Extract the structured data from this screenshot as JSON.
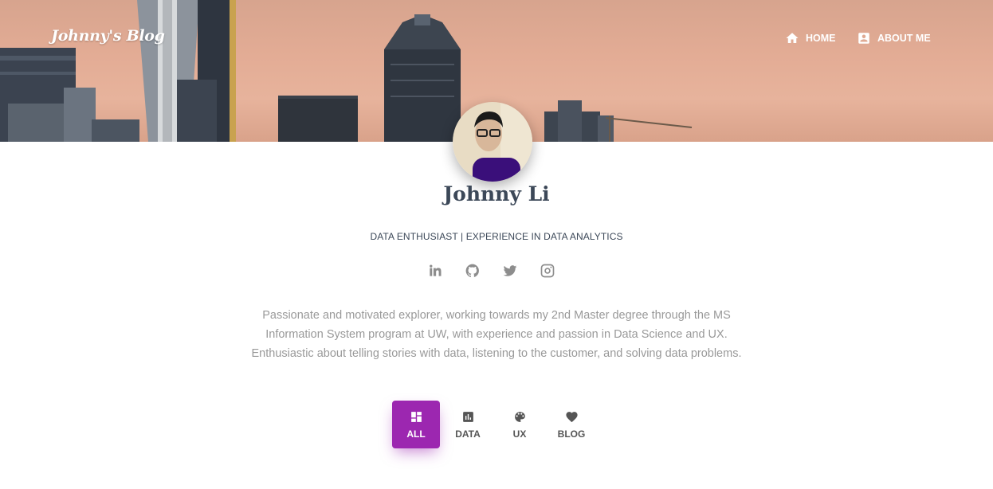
{
  "header": {
    "brand": "Johnny's Blog",
    "nav": [
      {
        "label": "HOME",
        "icon": "home-icon"
      },
      {
        "label": "ABOUT ME",
        "icon": "account-box-icon"
      }
    ],
    "banner": "city-skyline-at-dusk"
  },
  "profile": {
    "name": "Johnny Li",
    "tagline": "DATA ENTHUSIAST | EXPERIENCE IN DATA ANALYTICS",
    "social": [
      "linkedin-icon",
      "github-icon",
      "twitter-icon",
      "instagram-icon"
    ],
    "bio_lines": [
      "Passionate and motivated explorer, working towards my 2nd Master degree through the MS",
      "Information System program at UW, with experience and passion in Data Science and UX.",
      "Enthusiastic about telling stories with data, listening to the customer, and solving data problems."
    ]
  },
  "tabs": [
    {
      "label": "ALL",
      "icon": "dashboard-icon",
      "active": true
    },
    {
      "label": "DATA",
      "icon": "bar-chart-icon",
      "active": false
    },
    {
      "label": "UX",
      "icon": "palette-icon",
      "active": false
    },
    {
      "label": "BLOG",
      "icon": "heart-icon",
      "active": false
    }
  ],
  "colors": {
    "accent": "#9c27b0",
    "heading": "#3c4858",
    "muted_text": "#999999",
    "icon_gray": "#8d8d8d"
  }
}
